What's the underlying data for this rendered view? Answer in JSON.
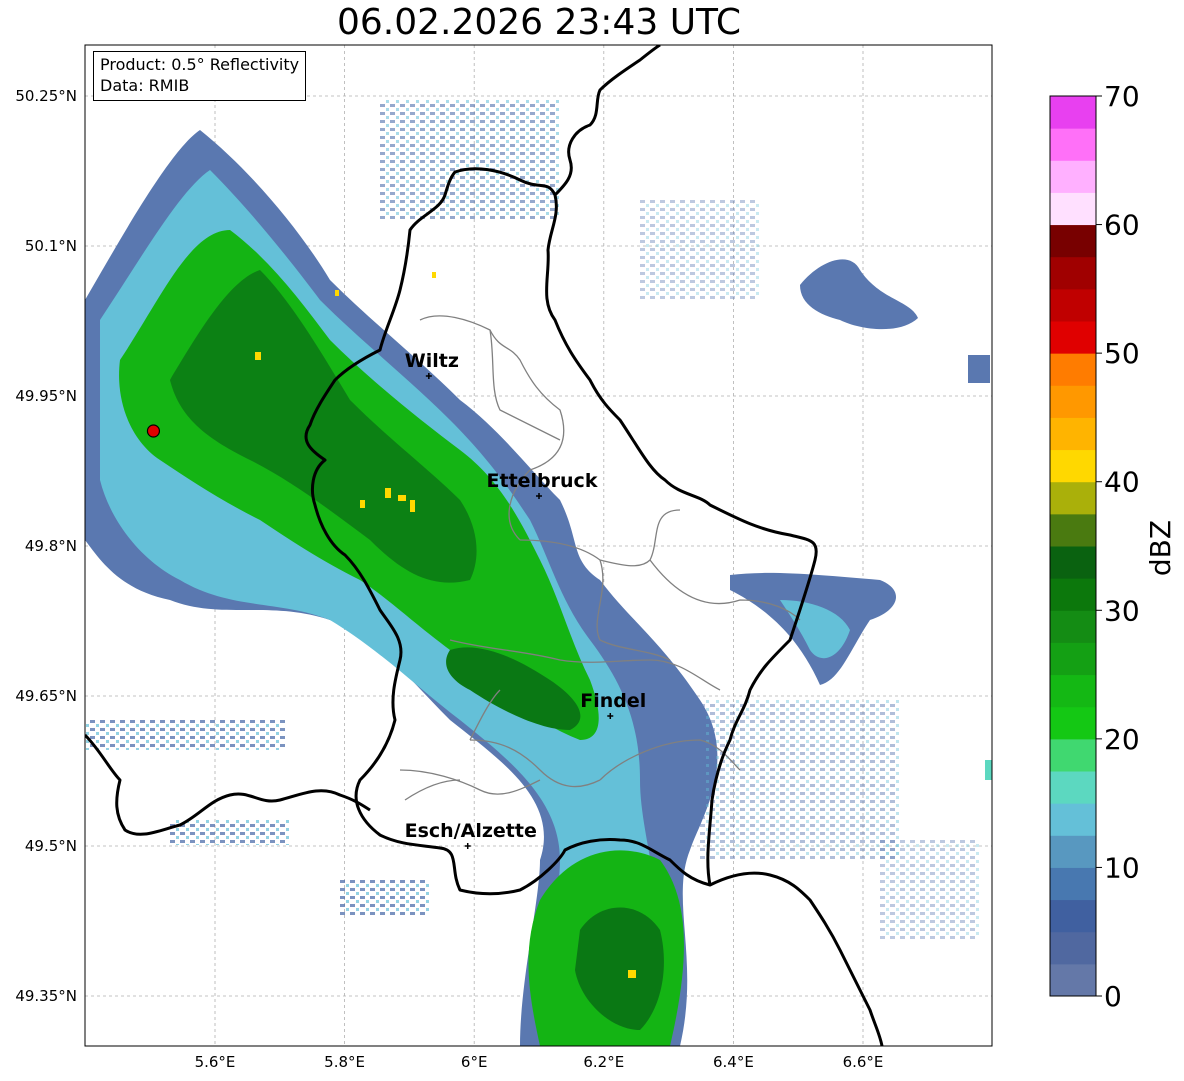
{
  "title": "06.02.2026 23:43 UTC",
  "info_box": {
    "product": "Product: 0.5° Reflectivity",
    "data": "Data: RMIB"
  },
  "map": {
    "lon_range": [
      5.4,
      6.8
    ],
    "lat_range": [
      49.3,
      50.3
    ],
    "lon_ticks": [
      {
        "value": 5.6,
        "label": "5.6°E"
      },
      {
        "value": 5.8,
        "label": "5.8°E"
      },
      {
        "value": 6.0,
        "label": "6°E"
      },
      {
        "value": 6.2,
        "label": "6.2°E"
      },
      {
        "value": 6.4,
        "label": "6.4°E"
      },
      {
        "value": 6.6,
        "label": "6.6°E"
      }
    ],
    "lat_ticks": [
      {
        "value": 50.25,
        "label": "50.25°N"
      },
      {
        "value": 50.1,
        "label": "50.1°N"
      },
      {
        "value": 49.95,
        "label": "49.95°N"
      },
      {
        "value": 49.8,
        "label": "49.8°N"
      },
      {
        "value": 49.65,
        "label": "49.65°N"
      },
      {
        "value": 49.5,
        "label": "49.5°N"
      },
      {
        "value": 49.35,
        "label": "49.35°N"
      }
    ],
    "cities": [
      {
        "name": "Wiltz",
        "lon": 5.93,
        "lat": 49.97
      },
      {
        "name": "Ettelbruck",
        "lon": 6.1,
        "lat": 49.85
      },
      {
        "name": "Findel",
        "lon": 6.21,
        "lat": 49.63
      },
      {
        "name": "Esch/Alzette",
        "lon": 5.99,
        "lat": 49.5
      }
    ],
    "radar_site": {
      "lon": 5.505,
      "lat": 49.915,
      "color": "#e00000"
    }
  },
  "colorbar": {
    "label": "dBZ",
    "min": 0,
    "max": 70,
    "tick_labels": [
      "0",
      "10",
      "20",
      "30",
      "40",
      "50",
      "60",
      "70"
    ],
    "colors": [
      "#6478a8",
      "#5068a0",
      "#4060a0",
      "#4878b0",
      "#5898c0",
      "#64c0d8",
      "#5cd8c0",
      "#40d870",
      "#14c814",
      "#14b814",
      "#14a014",
      "#148c14",
      "#0c780c",
      "#0a6210",
      "#4a7a10",
      "#aab00a",
      "#ffd800",
      "#ffb400",
      "#ff9800",
      "#ff7c00",
      "#e00000",
      "#c00000",
      "#a00000",
      "#780000",
      "#ffe0ff",
      "#ffb0ff",
      "#ff70f8",
      "#e840f0"
    ]
  },
  "echo_colors": {
    "light_blue": "#5a78b0",
    "cyan": "#5cc8d0",
    "green": "#14b414",
    "dark_green": "#0a7814",
    "yellow": "#ffd800"
  }
}
